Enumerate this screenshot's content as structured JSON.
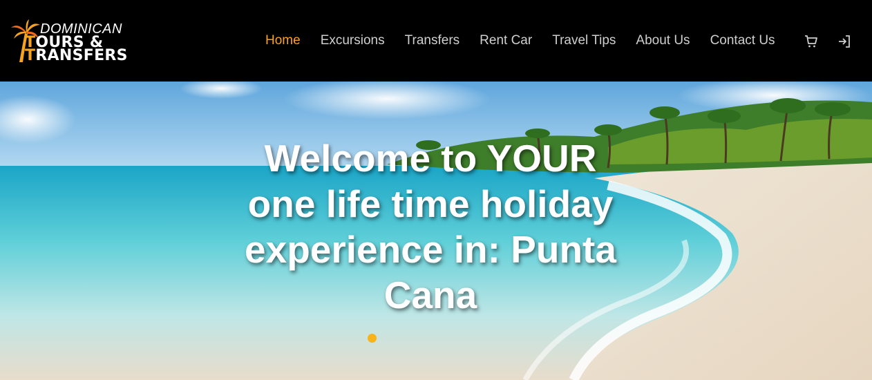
{
  "brand": {
    "line1": "DOMINICAN",
    "line2_accent": "T",
    "line2": "OURS &",
    "line3_accent": "T",
    "line3": "RANSFERS",
    "accent_color": "#f6a31e"
  },
  "nav": {
    "items": [
      {
        "label": "Home",
        "active": true
      },
      {
        "label": "Excursions",
        "active": false
      },
      {
        "label": "Transfers",
        "active": false
      },
      {
        "label": "Rent Car",
        "active": false
      },
      {
        "label": "Travel Tips",
        "active": false
      },
      {
        "label": "About Us",
        "active": false
      },
      {
        "label": "Contact Us",
        "active": false
      }
    ],
    "icons": [
      "cart-icon",
      "login-icon"
    ],
    "active_color": "#f6a31e"
  },
  "hero": {
    "title": "Welcome to YOUR one life time holiday experience in: Punta Cana",
    "slider_dot_color": "#f6b41a"
  }
}
